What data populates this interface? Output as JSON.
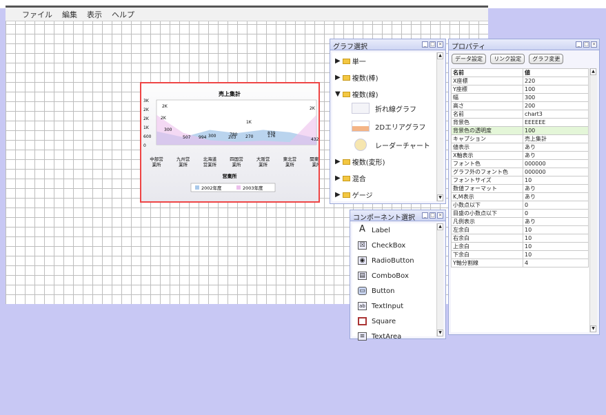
{
  "menu": [
    "ファイル",
    "編集",
    "表示",
    "ヘルプ"
  ],
  "chart_panel": {
    "selected_border": "#ee4444"
  },
  "chart_data": {
    "type": "area",
    "title": "売上集計",
    "xlabel": "営業所",
    "ylabel": "",
    "yticks": [
      "0",
      "600",
      "1K",
      "2K",
      "2K",
      "3K"
    ],
    "categories": [
      "中部営業所",
      "九州営業所",
      "北海道営業所",
      "四国営業所",
      "大阪営業所",
      "東北営業所",
      "関東営業所"
    ],
    "series": [
      {
        "name": "2002年度",
        "values": [
          900,
          507,
          994,
          780,
          1000,
          839,
          432
        ],
        "color": "#a9c9ea"
      },
      {
        "name": "2003年度",
        "values": [
          2000,
          800,
          300,
          200,
          270,
          176,
          2000
        ],
        "color": "#ecc0ec"
      }
    ],
    "data_labels": [
      "2K",
      "2K",
      "300",
      "507",
      "994",
      "300",
      "780",
      "203",
      "1K",
      "270",
      "839",
      "176",
      "2K",
      "432"
    ],
    "ylim": [
      0,
      3000
    ],
    "legend": "bottom",
    "grid": false
  },
  "graph_select": {
    "title": "グラフ選択",
    "items": [
      {
        "label": "単一",
        "expanded": false
      },
      {
        "label": "複数(棒)",
        "expanded": false
      },
      {
        "label": "複数(線)",
        "expanded": true
      },
      {
        "label": "複数(変形)",
        "expanded": false
      },
      {
        "label": "混合",
        "expanded": false
      },
      {
        "label": "ゲージ",
        "expanded": false
      }
    ],
    "sub_items": [
      "折れ線グラフ",
      "2Dエリアグラフ",
      "レーダーチャート"
    ]
  },
  "component_select": {
    "title": "コンポーネント選択",
    "items": [
      {
        "label": "Label",
        "icon": "A"
      },
      {
        "label": "CheckBox",
        "icon": "☒"
      },
      {
        "label": "RadioButton",
        "icon": "◉"
      },
      {
        "label": "ComboBox",
        "icon": "▤"
      },
      {
        "label": "Button",
        "icon": "▭"
      },
      {
        "label": "TextInput",
        "icon": "ab"
      },
      {
        "label": "Square",
        "icon": "□"
      },
      {
        "label": "TextArea",
        "icon": "≡"
      }
    ]
  },
  "properties": {
    "title": "プロパティ",
    "buttons": [
      "データ設定",
      "リンク設定",
      "グラフ変更"
    ],
    "col_name": "名前",
    "col_value": "値",
    "rows": [
      [
        "X座標",
        "220"
      ],
      [
        "Y座標",
        "100"
      ],
      [
        "幅",
        "300"
      ],
      [
        "高さ",
        "200"
      ],
      [
        "名前",
        "chart3"
      ],
      [
        "背景色",
        "EEEEEE"
      ],
      [
        "背景色の透明度",
        "100"
      ],
      [
        "キャプション",
        "売上集計"
      ],
      [
        "値表示",
        "あり"
      ],
      [
        "X軸表示",
        "あり"
      ],
      [
        "フォント色",
        "000000"
      ],
      [
        "グラフ外のフォント色",
        "000000"
      ],
      [
        "フォントサイズ",
        "10"
      ],
      [
        "数値フォーマット",
        "あり"
      ],
      [
        "K,M表示",
        "あり"
      ],
      [
        "小数点以下",
        "0"
      ],
      [
        "目盛の小数点以下",
        "0"
      ],
      [
        "凡例表示",
        "あり"
      ],
      [
        "左余白",
        "10"
      ],
      [
        "右余白",
        "10"
      ],
      [
        "上余白",
        "10"
      ],
      [
        "下余白",
        "10"
      ],
      [
        "Y軸分割線",
        "4"
      ]
    ],
    "highlight_row": 6
  }
}
